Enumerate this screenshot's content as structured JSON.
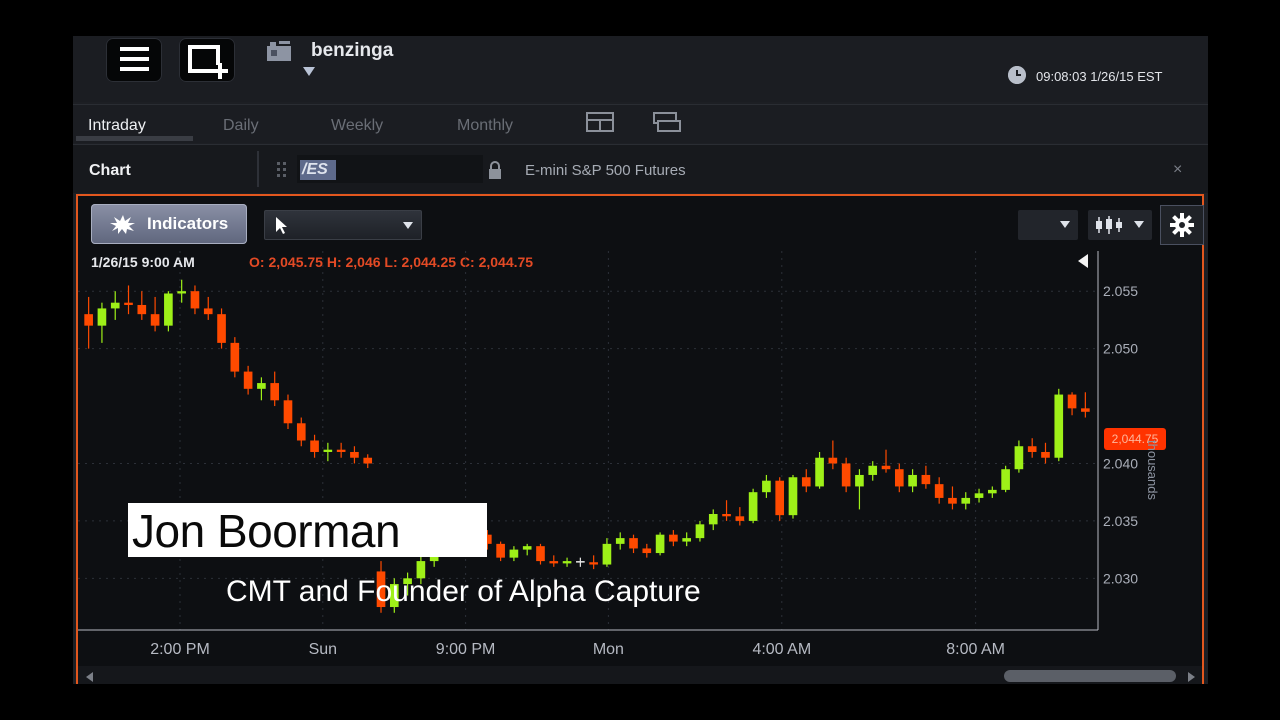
{
  "topbar": {
    "workspace_name": "benzinga",
    "clock": "09:08:03 1/26/15 EST"
  },
  "tabs": [
    "Intraday",
    "Daily",
    "Weekly",
    "Monthly"
  ],
  "chart_header": {
    "title": "Chart",
    "symbol": "/ES",
    "description": "E-mini S&P 500 Futures",
    "close_label": "×"
  },
  "toolbar": {
    "indicators_label": "Indicators"
  },
  "info": {
    "datetime": "1/26/15  9:00 AM",
    "ohlc": "O: 2,045.75  H: 2,046  L: 2,044.25  C: 2,044.75"
  },
  "price_marker": "2,044.75",
  "colors": {
    "up": "#9ef018",
    "down": "#ff4a00",
    "doji": "#e8e8e8",
    "accent_border": "#e2571e"
  },
  "overlay": {
    "name": "Jon Boorman",
    "title": "CMT and Founder of Alpha Capture"
  },
  "chart_data": {
    "type": "candlestick",
    "y_unit": "thousands",
    "y_ticks": [
      "2.055",
      "2.050",
      "2.040",
      "2.035",
      "2.030"
    ],
    "y_tick_values": [
      2.055,
      2.05,
      2.04,
      2.035,
      2.03
    ],
    "x_ticks": [
      "2:00 PM",
      "Sun",
      "9:00 PM",
      "Mon",
      "4:00 AM",
      "8:00 AM"
    ],
    "x_tick_positions": [
      10,
      24,
      38,
      52,
      69,
      88
    ],
    "ylim": [
      2.0255,
      2.0585
    ],
    "grid": true,
    "candles": [
      [
        2.053,
        2.0545,
        2.05,
        2.052
      ],
      [
        2.052,
        2.054,
        2.0505,
        2.0535
      ],
      [
        2.0535,
        2.055,
        2.0525,
        2.054
      ],
      [
        2.054,
        2.0555,
        2.053,
        2.0538
      ],
      [
        2.0538,
        2.055,
        2.0525,
        2.053
      ],
      [
        2.053,
        2.0545,
        2.0515,
        2.052
      ],
      [
        2.052,
        2.055,
        2.0515,
        2.0548
      ],
      [
        2.0548,
        2.056,
        2.054,
        2.055
      ],
      [
        2.055,
        2.0555,
        2.053,
        2.0535
      ],
      [
        2.0535,
        2.0545,
        2.0525,
        2.053
      ],
      [
        2.053,
        2.0535,
        2.05,
        2.0505
      ],
      [
        2.0505,
        2.051,
        2.0475,
        2.048
      ],
      [
        2.048,
        2.0485,
        2.046,
        2.0465
      ],
      [
        2.0465,
        2.0475,
        2.0455,
        2.047
      ],
      [
        2.047,
        2.048,
        2.045,
        2.0455
      ],
      [
        2.0455,
        2.046,
        2.043,
        2.0435
      ],
      [
        2.0435,
        2.044,
        2.0415,
        2.042
      ],
      [
        2.042,
        2.0425,
        2.0405,
        2.041
      ],
      [
        2.041,
        2.0418,
        2.0402,
        2.0412
      ],
      [
        2.0412,
        2.0418,
        2.0405,
        2.041
      ],
      [
        2.041,
        2.0415,
        2.04,
        2.0405
      ],
      [
        2.0405,
        2.0408,
        2.0396,
        2.04
      ],
      [
        2.0306,
        2.0315,
        2.027,
        2.0275
      ],
      [
        2.0275,
        2.03,
        2.027,
        2.0295
      ],
      [
        2.0295,
        2.0305,
        2.0285,
        2.03
      ],
      [
        2.03,
        2.032,
        2.0295,
        2.0315
      ],
      [
        2.0315,
        2.0335,
        2.031,
        2.033
      ],
      [
        2.033,
        2.034,
        2.0325,
        2.0335
      ],
      [
        2.0335,
        2.034,
        2.033,
        2.0336
      ],
      [
        2.0336,
        2.0342,
        2.033,
        2.0338
      ],
      [
        2.0338,
        2.0342,
        2.0325,
        2.033
      ],
      [
        2.033,
        2.0332,
        2.0315,
        2.0318
      ],
      [
        2.0318,
        2.0328,
        2.0315,
        2.0325
      ],
      [
        2.0325,
        2.033,
        2.032,
        2.0328
      ],
      [
        2.0328,
        2.033,
        2.0312,
        2.0315
      ],
      [
        2.0315,
        2.032,
        2.031,
        2.0313
      ],
      [
        2.0313,
        2.0318,
        2.031,
        2.0315
      ],
      [
        2.0315,
        2.0318,
        2.031,
        2.0314
      ],
      [
        2.0314,
        2.032,
        2.0308,
        2.0312
      ],
      [
        2.0312,
        2.0335,
        2.031,
        2.033
      ],
      [
        2.033,
        2.034,
        2.0325,
        2.0335
      ],
      [
        2.0335,
        2.0338,
        2.0322,
        2.0326
      ],
      [
        2.0326,
        2.033,
        2.0318,
        2.0322
      ],
      [
        2.0322,
        2.034,
        2.032,
        2.0338
      ],
      [
        2.0338,
        2.0342,
        2.0328,
        2.0332
      ],
      [
        2.0332,
        2.034,
        2.0328,
        2.0335
      ],
      [
        2.0335,
        2.035,
        2.0332,
        2.0347
      ],
      [
        2.0347,
        2.036,
        2.0342,
        2.0356
      ],
      [
        2.0356,
        2.0368,
        2.035,
        2.0354
      ],
      [
        2.0354,
        2.0362,
        2.0346,
        2.035
      ],
      [
        2.035,
        2.0378,
        2.0348,
        2.0375
      ],
      [
        2.0375,
        2.039,
        2.037,
        2.0385
      ],
      [
        2.0385,
        2.0388,
        2.035,
        2.0355
      ],
      [
        2.0355,
        2.039,
        2.0352,
        2.0388
      ],
      [
        2.0388,
        2.0395,
        2.0375,
        2.038
      ],
      [
        2.038,
        2.041,
        2.0378,
        2.0405
      ],
      [
        2.0405,
        2.042,
        2.0395,
        2.04
      ],
      [
        2.04,
        2.0405,
        2.0375,
        2.038
      ],
      [
        2.038,
        2.0395,
        2.036,
        2.039
      ],
      [
        2.039,
        2.0402,
        2.0385,
        2.0398
      ],
      [
        2.0398,
        2.0412,
        2.0392,
        2.0395
      ],
      [
        2.0395,
        2.04,
        2.0375,
        2.038
      ],
      [
        2.038,
        2.0395,
        2.0375,
        2.039
      ],
      [
        2.039,
        2.0398,
        2.0378,
        2.0382
      ],
      [
        2.0382,
        2.0388,
        2.0365,
        2.037
      ],
      [
        2.037,
        2.038,
        2.036,
        2.0365
      ],
      [
        2.0365,
        2.0375,
        2.036,
        2.037
      ],
      [
        2.037,
        2.0378,
        2.0366,
        2.0374
      ],
      [
        2.0374,
        2.038,
        2.037,
        2.0377
      ],
      [
        2.0377,
        2.0398,
        2.0375,
        2.0395
      ],
      [
        2.0395,
        2.042,
        2.0392,
        2.0415
      ],
      [
        2.0415,
        2.0422,
        2.0405,
        2.041
      ],
      [
        2.041,
        2.0418,
        2.04,
        2.0405
      ],
      [
        2.0405,
        2.0465,
        2.0402,
        2.046
      ],
      [
        2.046,
        2.0462,
        2.0442,
        2.0448
      ],
      [
        2.0448,
        2.0462,
        2.044,
        2.0445
      ]
    ]
  }
}
